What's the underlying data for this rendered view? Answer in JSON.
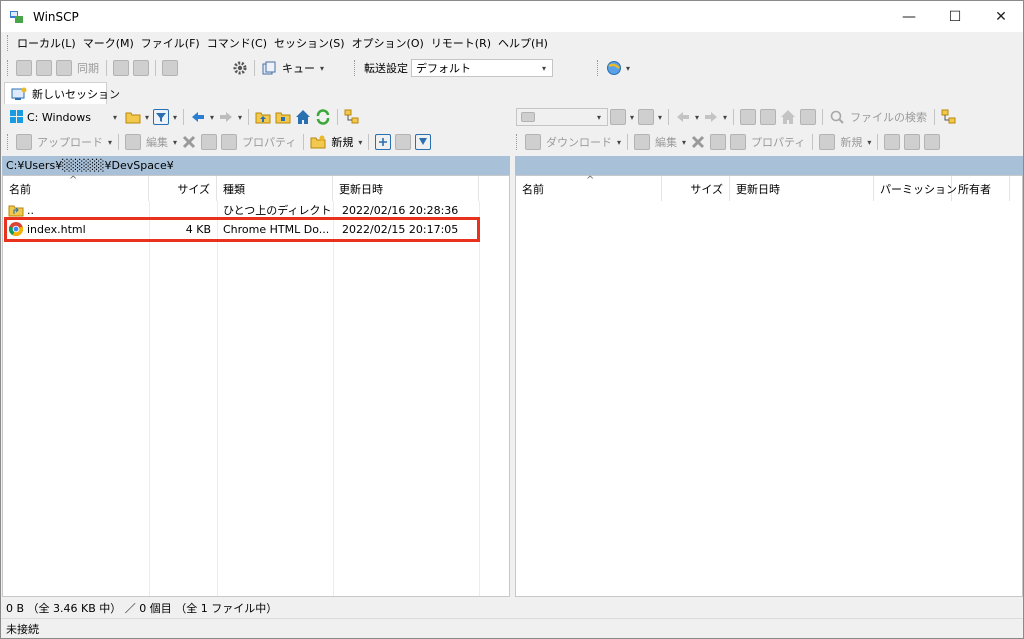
{
  "window": {
    "title": "WinSCP",
    "minimize": "—",
    "maximize": "☐",
    "close": "✕"
  },
  "menu": [
    "ローカル(L)",
    "マーク(M)",
    "ファイル(F)",
    "コマンド(C)",
    "セッション(S)",
    "オプション(O)",
    "リモート(R)",
    "ヘルプ(H)"
  ],
  "toolbar1": {
    "sync_label": "同期",
    "queue_label": "キュー",
    "transfer_label": "転送設定",
    "transfer_value": "デフォルト"
  },
  "session_tab": {
    "label": "新しいセッション"
  },
  "local": {
    "drive": "C: Windows",
    "upload": "アップロード",
    "edit": "編集",
    "properties": "プロパティ",
    "new": "新規",
    "path": "C:¥Users¥░░░░░¥DevSpace¥",
    "columns": [
      "名前",
      "サイズ",
      "種類",
      "更新日時"
    ],
    "rows": [
      {
        "name": "..",
        "size": "",
        "type": "ひとつ上のディレクトリ",
        "date": "2022/02/16  20:28:36"
      },
      {
        "name": "index.html",
        "size": "4 KB",
        "type": "Chrome HTML Do...",
        "date": "2022/02/15  20:17:05"
      }
    ]
  },
  "remote": {
    "search": "ファイルの検索",
    "download": "ダウンロード",
    "edit": "編集",
    "properties": "プロパティ",
    "new": "新規",
    "columns": [
      "名前",
      "サイズ",
      "更新日時",
      "パーミッション",
      "所有者"
    ]
  },
  "status": {
    "line1": "0 B （全 3.46 KB 中） ／ 0 個目 （全 1 ファイル中）",
    "line2": "未接続"
  },
  "colors": {
    "pathbar": "#a8c0d8",
    "highlight": "#e8321d",
    "accent": "#1a6fd0"
  }
}
